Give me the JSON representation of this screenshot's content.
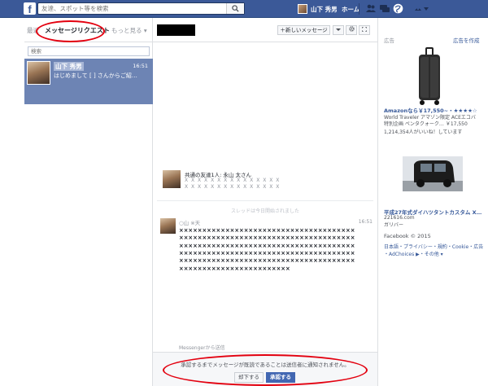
{
  "colors": {
    "brand": "#3b5998",
    "selected_row": "#6d84b4",
    "annotation_ring": "#e3000f",
    "accept_button": "#4267b2"
  },
  "topbar": {
    "search_placeholder": "友達、スポット等を検索",
    "user_name": "山下 秀男",
    "home_label": "ホーム",
    "icons": [
      "friend-requests-icon",
      "messages-icon",
      "notifications-icon",
      "privacy-icon",
      "settings-arrow-icon"
    ]
  },
  "left": {
    "tab_inbox": "最近",
    "tab_requests": "メッセージリクエスト",
    "tab_more": "もっと見る ▾",
    "search_placeholder": "検索",
    "conversation": {
      "name": "山下 秀男",
      "time": "16:51",
      "snippet": "はじめまして [ ] さんからご紹…"
    }
  },
  "center": {
    "new_message_label": "＋新しいメッセージ",
    "mutual_friend_text": "共通の友達1人: 永山 太さん",
    "mutual_placeholder_1": "X X X X X X X X X X X X X X X",
    "mutual_placeholder_2": "X X X X X X X X X X X X X X X",
    "thread_note": "スレッドは今日開始されました",
    "message": {
      "sender": "○山 ※天",
      "time": "16:51",
      "body": "××××××××××××××××××××××××××××××××××××××××××××××××××××××××××××××××××××××××××××××××××××××××××××××××××××××××××××××××××××××××××××××××××××××××××××××××××××××××××××××××××××××××××××××××××××××××××××××××××××××××××××××××××××××",
      "via": "Messengerから送信"
    },
    "footer_note": "承認するまでメッセージが既読であることは送信者に通知されません。",
    "delete_label": "却下する",
    "accept_label": "承認する"
  },
  "right": {
    "ads_header": "広告",
    "ads_create": "広告を作成",
    "ad1": {
      "title": "Amazonなら￥17,550~・★★★★☆",
      "line1": "World Traveler アマゾン限定 ACEエコバ",
      "line2": "特別企画 ペンタクォーク…  ￥17,550",
      "likes": "1,214,354人がいいね！しています"
    },
    "ad2": {
      "title": "平成27年式ダイハツタントカスタム X…",
      "line1": "221616.com",
      "line2": "ガリバー"
    },
    "footer_copyright": "Facebook © 2015",
    "footer_links_1": "日本語・プライバシー・規約・Cookie・広告",
    "footer_links_2": "・AdChoices ▶・その他 ▾"
  }
}
